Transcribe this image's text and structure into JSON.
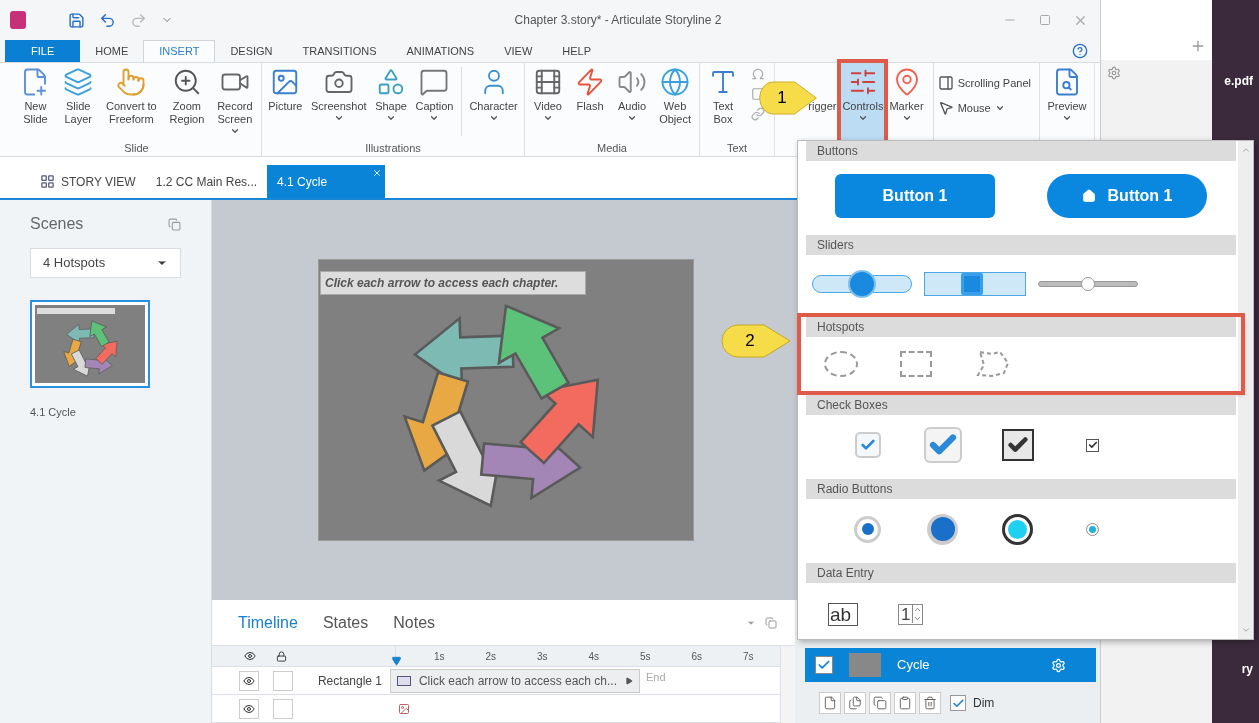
{
  "window": {
    "title": "Chapter 3.story* - Articulate Storyline 2"
  },
  "ribbon_tabs": [
    {
      "label": "FILE",
      "kind": "file",
      "selected": false
    },
    {
      "label": "HOME",
      "kind": "tab",
      "selected": false
    },
    {
      "label": "INSERT",
      "kind": "tab",
      "selected": true
    },
    {
      "label": "DESIGN",
      "kind": "tab",
      "selected": false
    },
    {
      "label": "TRANSITIONS",
      "kind": "tab",
      "selected": false
    },
    {
      "label": "ANIMATIONS",
      "kind": "tab",
      "selected": false
    },
    {
      "label": "VIEW",
      "kind": "tab",
      "selected": false
    },
    {
      "label": "HELP",
      "kind": "tab",
      "selected": false
    }
  ],
  "ribbon_groups": [
    {
      "label": "Slide",
      "items": [
        {
          "kind": "large",
          "label": "New\nSlide",
          "dropdown": false
        },
        {
          "kind": "large",
          "label": "Slide\nLayer",
          "dropdown": false
        },
        {
          "kind": "large",
          "label": "Convert to\nFreeform",
          "dropdown": false
        },
        {
          "kind": "large",
          "label": "Zoom\nRegion",
          "dropdown": false
        },
        {
          "kind": "large",
          "label": "Record\nScreen",
          "dropdown": true
        }
      ]
    },
    {
      "label": "Illustrations",
      "items": [
        {
          "kind": "large",
          "label": "Picture",
          "dropdown": false
        },
        {
          "kind": "large",
          "label": "Screenshot",
          "dropdown": true
        },
        {
          "kind": "large",
          "label": "Shape",
          "dropdown": true
        },
        {
          "kind": "large",
          "label": "Caption",
          "dropdown": true
        },
        {
          "kind": "separator"
        },
        {
          "kind": "large",
          "label": "Character",
          "dropdown": true
        }
      ]
    },
    {
      "label": "Media",
      "items": [
        {
          "kind": "large",
          "label": "Video",
          "dropdown": true
        },
        {
          "kind": "large",
          "label": "Flash",
          "dropdown": false
        },
        {
          "kind": "large",
          "label": "Audio",
          "dropdown": true
        },
        {
          "kind": "large",
          "label": "Web\nObject",
          "dropdown": false
        }
      ]
    },
    {
      "label": "Text",
      "items": [
        {
          "kind": "large",
          "label": "Text\nBox",
          "dropdown": false
        },
        {
          "kind": "icon_stack"
        }
      ]
    },
    {
      "items": [
        {
          "kind": "large",
          "label": "rigger",
          "dropdown": false,
          "pressed": false
        },
        {
          "kind": "large",
          "label": "Controls",
          "dropdown": true,
          "pressed": true,
          "highlighted": true
        },
        {
          "kind": "large",
          "label": "Marker",
          "dropdown": true,
          "pressed": false
        },
        {
          "kind": "stack",
          "entries": [
            {
              "label": "Scrolling Panel",
              "dropdown": false
            },
            {
              "label": "Mouse",
              "dropdown": true
            }
          ],
          "pressed": false
        }
      ]
    },
    {
      "items": [
        {
          "kind": "large",
          "label": "Preview",
          "dropdown": true
        }
      ]
    }
  ],
  "doc_tabs": [
    {
      "label": "STORY VIEW",
      "kind": "story",
      "selected": false
    },
    {
      "label": "1.2 CC Main Res...",
      "kind": "slide",
      "selected": false
    },
    {
      "label": "4.1 Cycle",
      "kind": "slide",
      "selected": true
    }
  ],
  "scenes": {
    "title": "Scenes",
    "scene": "4 Hotspots",
    "slides": [
      {
        "label": "4.1 Cycle",
        "selected": true
      }
    ]
  },
  "slide": {
    "caption": "Click each arrow to access each chapter.",
    "arrows": [
      {
        "color": "#7dbab3"
      },
      {
        "color": "#e8a843"
      },
      {
        "color": "#d9d9d9"
      },
      {
        "color": "#a385b6"
      },
      {
        "color": "#f26b5e"
      },
      {
        "color": "#5cc27a"
      }
    ]
  },
  "timeline": {
    "tabs": [
      {
        "label": "Timeline",
        "selected": true
      },
      {
        "label": "States",
        "selected": false
      },
      {
        "label": "Notes",
        "selected": false
      }
    ],
    "ticks": [
      "1s",
      "2s",
      "3s",
      "4s",
      "5s",
      "6s",
      "7s"
    ],
    "rows": [
      {
        "kind": "text",
        "visible": true,
        "locked": false,
        "name": "Rectangle 1",
        "text": "Click each arrow to access each ch...",
        "end": "End"
      },
      {
        "kind": "picture",
        "visible": true,
        "locked": false
      }
    ]
  },
  "layers": {
    "items": [
      {
        "name": "Cycle",
        "checked": true,
        "selected": true
      }
    ],
    "dim": {
      "label": "Dim",
      "checked": true
    }
  },
  "controls_menu": {
    "sections": [
      {
        "heading": "Buttons",
        "kind": "buttons",
        "highlighted": false,
        "items": [
          {
            "kind": "rect",
            "label": "Button 1"
          },
          {
            "kind": "pill",
            "label": "Button 1"
          }
        ]
      },
      {
        "heading": "Sliders",
        "kind": "sliders",
        "highlighted": false,
        "items": [
          {
            "kind": "pill",
            "level": 0.5
          },
          {
            "kind": "square",
            "level": 0.47
          },
          {
            "kind": "thin",
            "level": 0.5
          }
        ]
      },
      {
        "heading": "Hotspots",
        "kind": "hotspots",
        "highlighted": true,
        "items": [
          {
            "kind": "oval"
          },
          {
            "kind": "rectangle"
          },
          {
            "kind": "freeform"
          }
        ]
      },
      {
        "heading": "Check Boxes",
        "kind": "checkboxes",
        "highlighted": false,
        "items": [
          {
            "kind": "soft",
            "checked": true
          },
          {
            "kind": "large",
            "checked": true
          },
          {
            "kind": "dark",
            "checked": true
          },
          {
            "kind": "tiny",
            "checked": true
          }
        ]
      },
      {
        "heading": "Radio Buttons",
        "kind": "radios",
        "highlighted": false,
        "items": [
          {
            "kind": "soft",
            "selected": true
          },
          {
            "kind": "large",
            "selected": true
          },
          {
            "kind": "dark",
            "selected": true
          },
          {
            "kind": "tiny",
            "selected": true
          }
        ]
      },
      {
        "heading": "Data Entry",
        "kind": "entry",
        "highlighted": false,
        "items": [
          {
            "kind": "text",
            "value": "ab"
          },
          {
            "kind": "number",
            "value": "1"
          }
        ]
      }
    ]
  },
  "callouts": [
    {
      "label": "1"
    },
    {
      "label": "2"
    }
  ],
  "background_window": {
    "file_label": "e.pdf",
    "text_fragment": "ry"
  }
}
